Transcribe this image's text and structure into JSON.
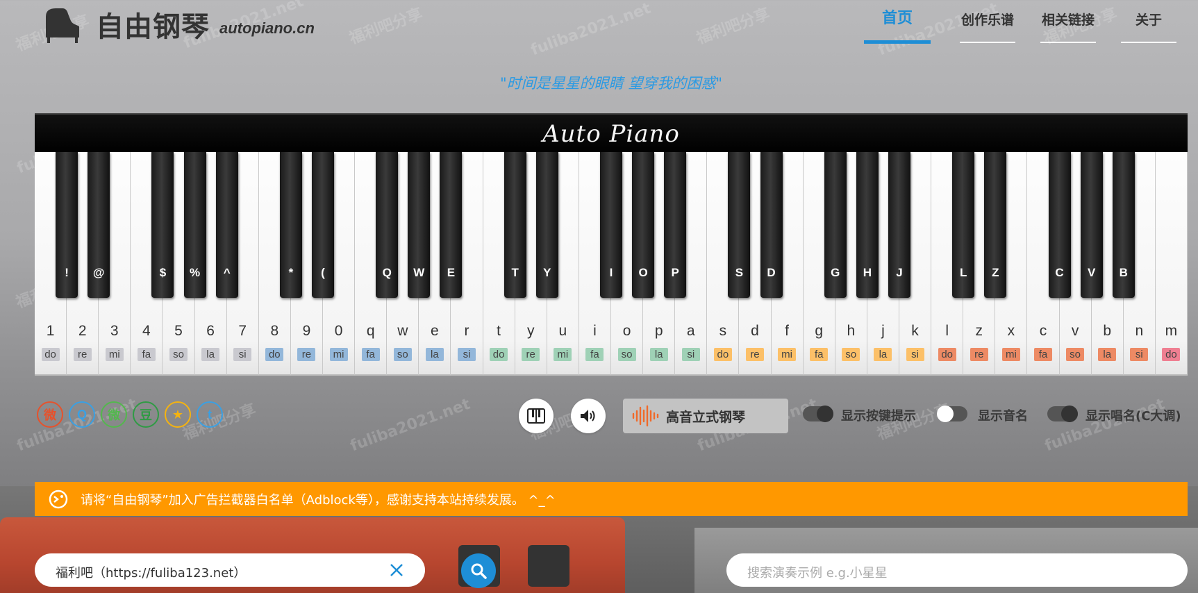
{
  "logo": {
    "title": "自由钢琴",
    "domain": "autopiano.cn"
  },
  "nav": [
    {
      "label": "首页",
      "active": true
    },
    {
      "label": "创作乐谱",
      "active": false
    },
    {
      "label": "相关链接",
      "active": false
    },
    {
      "label": "关于",
      "active": false
    }
  ],
  "quote": "\"时间是星星的眼睛 望穿我的困惑\"",
  "piano": {
    "brand": "Auto Piano",
    "white_keys": [
      {
        "key": "1",
        "sol": "do"
      },
      {
        "key": "2",
        "sol": "re"
      },
      {
        "key": "3",
        "sol": "mi"
      },
      {
        "key": "4",
        "sol": "fa"
      },
      {
        "key": "5",
        "sol": "so"
      },
      {
        "key": "6",
        "sol": "la"
      },
      {
        "key": "7",
        "sol": "si"
      },
      {
        "key": "8",
        "sol": "do"
      },
      {
        "key": "9",
        "sol": "re"
      },
      {
        "key": "0",
        "sol": "mi"
      },
      {
        "key": "q",
        "sol": "fa"
      },
      {
        "key": "w",
        "sol": "so"
      },
      {
        "key": "e",
        "sol": "la"
      },
      {
        "key": "r",
        "sol": "si"
      },
      {
        "key": "t",
        "sol": "do"
      },
      {
        "key": "y",
        "sol": "re"
      },
      {
        "key": "u",
        "sol": "mi"
      },
      {
        "key": "i",
        "sol": "fa"
      },
      {
        "key": "o",
        "sol": "so"
      },
      {
        "key": "p",
        "sol": "la"
      },
      {
        "key": "a",
        "sol": "si"
      },
      {
        "key": "s",
        "sol": "do"
      },
      {
        "key": "d",
        "sol": "re"
      },
      {
        "key": "f",
        "sol": "mi"
      },
      {
        "key": "g",
        "sol": "fa"
      },
      {
        "key": "h",
        "sol": "so"
      },
      {
        "key": "j",
        "sol": "la"
      },
      {
        "key": "k",
        "sol": "si"
      },
      {
        "key": "l",
        "sol": "do"
      },
      {
        "key": "z",
        "sol": "re"
      },
      {
        "key": "x",
        "sol": "mi"
      },
      {
        "key": "c",
        "sol": "fa"
      },
      {
        "key": "v",
        "sol": "so"
      },
      {
        "key": "b",
        "sol": "la"
      },
      {
        "key": "n",
        "sol": "si"
      },
      {
        "key": "m",
        "sol": "do"
      }
    ],
    "octave_colors": [
      "#c9c9cf",
      "#93b7da",
      "#9fd1b6",
      "#fcc068",
      "#ed8a64",
      "#ef7f92"
    ],
    "black_keys": [
      "!",
      "@",
      "$",
      "%",
      "^",
      "*",
      "(",
      "Q",
      "W",
      "E",
      "T",
      "Y",
      "I",
      "O",
      "P",
      "S",
      "D",
      "G",
      "H",
      "J",
      "L",
      "Z",
      "C",
      "V",
      "B"
    ]
  },
  "socials": [
    {
      "icon": "weibo-icon",
      "glyph": "微",
      "color": "#e6522c"
    },
    {
      "icon": "qq-icon",
      "glyph": "Q",
      "color": "#3aa0e3"
    },
    {
      "icon": "wechat-icon",
      "glyph": "微",
      "color": "#53b84d"
    },
    {
      "icon": "douban-icon",
      "glyph": "豆",
      "color": "#2f9b44"
    },
    {
      "icon": "qzone-icon",
      "glyph": "★",
      "color": "#f5b30f"
    },
    {
      "icon": "twitter-icon",
      "glyph": "t",
      "color": "#3aa0e3"
    }
  ],
  "controls": {
    "instrument": "高音立式钢琴",
    "toggles": [
      {
        "label": "显示按键提示",
        "on": true
      },
      {
        "label": "显示音名",
        "on": false
      },
      {
        "label": "显示唱名(C大调)",
        "on": true
      }
    ]
  },
  "notice": "请将“自由钢琴”加入广告拦截器白名单（Adblock等），感谢支持本站持续发展。 ^_^",
  "search_left": {
    "value": "福利吧（https://fuliba123.net）"
  },
  "search_right": {
    "placeholder": "搜索演奏示例  e.g.小星星"
  },
  "watermarks": [
    "福利吧分享",
    "fuliba2021.net"
  ]
}
